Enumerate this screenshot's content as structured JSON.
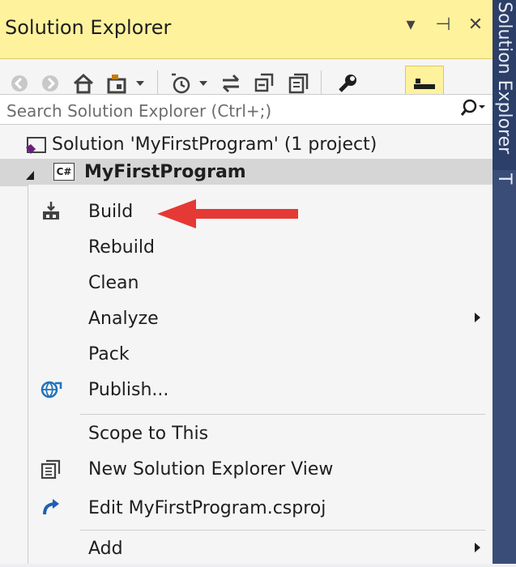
{
  "panel": {
    "title": "Solution Explorer",
    "title_buttons": [
      "▾",
      "⊣",
      "✕"
    ]
  },
  "search": {
    "placeholder": "Search Solution Explorer (Ctrl+;)"
  },
  "tree": {
    "solution": "Solution 'MyFirstProgram' (1 project)",
    "project": "MyFirstProgram",
    "project_badge": "C#"
  },
  "menu": {
    "items": [
      {
        "label": "Build",
        "icon": "build-icon"
      },
      {
        "label": "Rebuild"
      },
      {
        "label": "Clean"
      },
      {
        "label": "Analyze",
        "submenu": true
      },
      {
        "label": "Pack"
      },
      {
        "label": "Publish...",
        "icon": "globe-publish-icon"
      },
      {
        "label": "Scope to This"
      },
      {
        "label": "New Solution Explorer View",
        "icon": "new-view-icon"
      },
      {
        "label": "Edit MyFirstProgram.csproj",
        "icon": "redo-arrow-icon"
      },
      {
        "label": "Add",
        "submenu": true
      }
    ]
  },
  "side_tabs": [
    "Solution Explorer",
    "T"
  ],
  "colors": {
    "title_bg": "#fff29d",
    "side_bg": "#3a4d78",
    "arrow": "#e53935",
    "vs_purple": "#68217a"
  }
}
